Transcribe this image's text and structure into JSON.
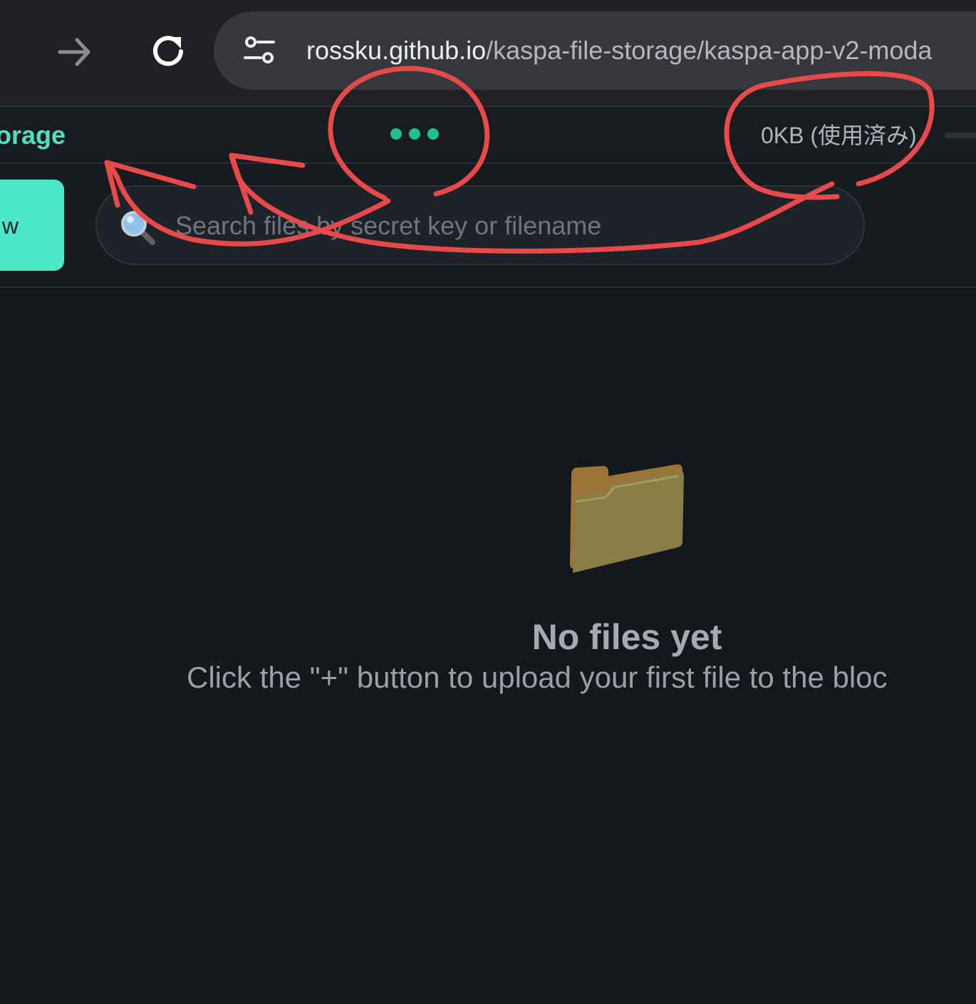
{
  "browser": {
    "url_domain": "rossku.github.io",
    "url_path": "/kaspa-file-storage/kaspa-app-v2-moda",
    "forward_icon": "arrow-right-icon",
    "reload_icon": "reload-icon",
    "site_info_icon": "tune-icon"
  },
  "header": {
    "title": "orage",
    "storage_used": "0KB (使用済み)"
  },
  "toolbar": {
    "new_button_label": "w",
    "search_placeholder": "Search files by secret key or filename",
    "search_value": ""
  },
  "empty_state": {
    "title": "No files yet",
    "subtitle": "Click the \"+\" button to upload your first file to the bloc"
  },
  "colors": {
    "accent": "#4ae8c9",
    "brand_text": "#4fe0c4",
    "loading_dot": "#1fc08e",
    "annotation": "#e8494a",
    "background": "#14171c"
  }
}
